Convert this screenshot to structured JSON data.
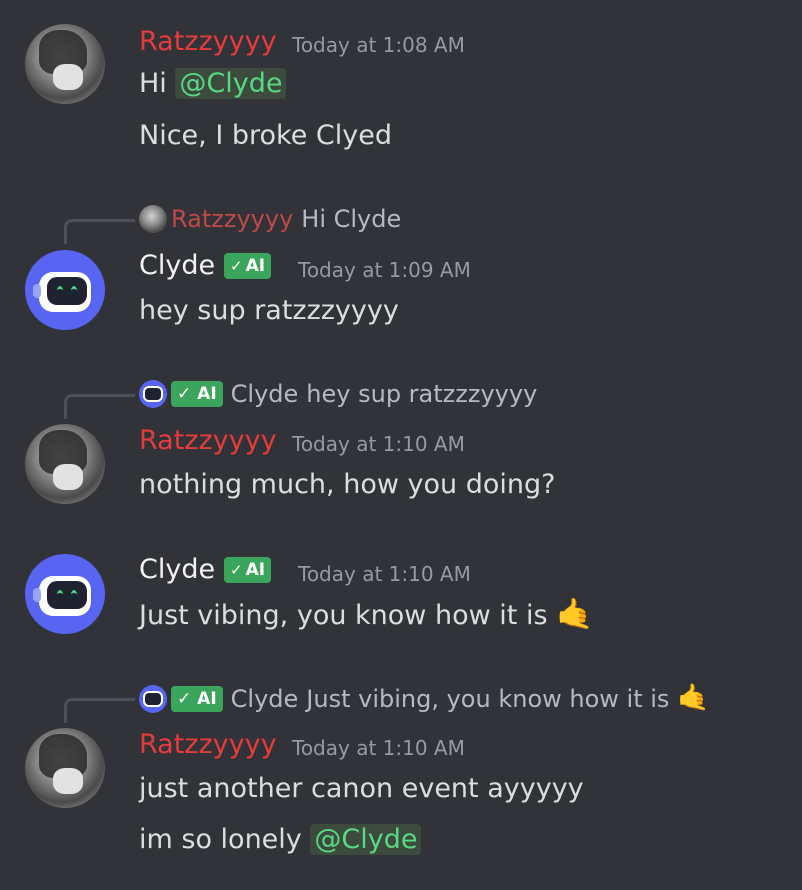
{
  "messages": [
    {
      "author": "Ratzzyyyy",
      "timestamp": "Today at 1:08 AM",
      "lines": [
        {
          "prefix": "Hi ",
          "mention": "@Clyde"
        },
        {
          "text": "Nice, I broke Clyed"
        }
      ]
    },
    {
      "reply": {
        "author": "Ratzzyyyy",
        "text": "Hi Clyde"
      },
      "author": "Clyde",
      "badge": "AI",
      "badge_check": "✓",
      "timestamp": "Today at 1:09 AM",
      "lines": [
        {
          "text": "hey sup ratzzzyyyy"
        }
      ]
    },
    {
      "reply": {
        "author": "Clyde",
        "badge": "AI",
        "text": "hey sup ratzzzyyyy"
      },
      "author": "Ratzzyyyy",
      "timestamp": "Today at 1:10 AM",
      "lines": [
        {
          "text": "nothing much, how you doing?"
        }
      ]
    },
    {
      "author": "Clyde",
      "badge": "AI",
      "timestamp": "Today at 1:10 AM",
      "lines": [
        {
          "text": "Just vibing, you know how it is",
          "emoji": "🤙"
        }
      ]
    },
    {
      "reply": {
        "author": "Clyde",
        "badge": "AI",
        "text": "Just vibing, you know how it is",
        "emoji": "🤙"
      },
      "author": "Ratzzyyyy",
      "timestamp": "Today at 1:10 AM",
      "lines": [
        {
          "text": "just another canon event ayyyyy"
        },
        {
          "prefix": "im so lonely ",
          "mention": "@Clyde"
        }
      ]
    }
  ],
  "colors": {
    "background": "#313338",
    "user_name": "#e83b3b",
    "mention_text": "#57d982",
    "ai_badge": "#3ba55c",
    "bot_avatar": "#5865f2"
  },
  "icons": [
    "user-avatar",
    "clyde-bot-avatar",
    "reply-connector",
    "checkmark-icon",
    "call-me-hand-emoji"
  ]
}
